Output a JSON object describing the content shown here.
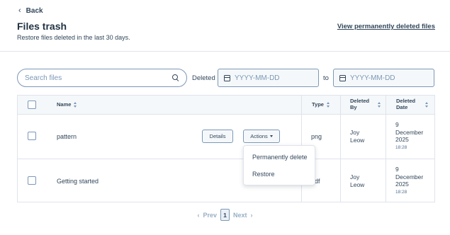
{
  "header": {
    "back_label": "Back",
    "title": "Files trash",
    "subtitle": "Restore files deleted in the last 30 days.",
    "view_link": "View permanently deleted files"
  },
  "filters": {
    "search_placeholder": "Search files",
    "deleted_label": "Deleted",
    "date_from_placeholder": "YYYY-MM-DD",
    "to_label": "to",
    "date_to_placeholder": "YYYY-MM-DD"
  },
  "table": {
    "columns": {
      "name": "Name",
      "type": "Type",
      "deleted_by_1": "Deleted",
      "deleted_by_2": "By",
      "deleted_date_1": "Deleted",
      "deleted_date_2": "Date"
    },
    "rows": [
      {
        "name": "pattern",
        "type": "png",
        "by_1": "Joy",
        "by_2": "Leow",
        "date_1": "9",
        "date_2": "December",
        "date_3": "2025",
        "time": "18:28"
      },
      {
        "name": "Getting started",
        "type": "pdf",
        "by_1": "Joy",
        "by_2": "Leow",
        "date_1": "9",
        "date_2": "December",
        "date_3": "2025",
        "time": "18:28"
      }
    ],
    "details_label": "Details",
    "actions_label": "Actions"
  },
  "dropdown": {
    "permanently_delete": "Permanently delete",
    "restore": "Restore"
  },
  "pagination": {
    "prev": "Prev",
    "page": "1",
    "next": "Next"
  }
}
